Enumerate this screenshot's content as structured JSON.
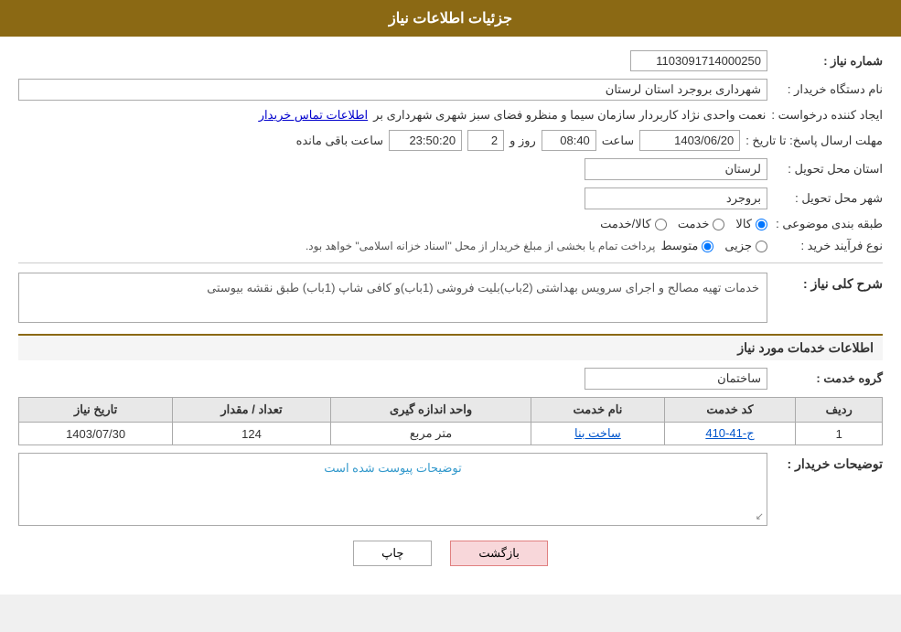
{
  "header": {
    "title": "جزئیات اطلاعات نیاز"
  },
  "fields": {
    "shomareNiaz_label": "شماره نیاز :",
    "shomareNiaz_value": "1103091714000250",
    "namDastgah_label": "نام دستگاه خریدار :",
    "namDastgah_value": "شهرداری بروجرد استان لرستان",
    "ijadKonande_label": "ایجاد کننده درخواست :",
    "ijadKonande_value": "نعمت واحدی نژاد کاربردار سازمان سیما و منظرو فضای سبز شهری شهرداری بر",
    "ijadKonande_link": "اطلاعات تماس خریدار",
    "mohlatErsal_label": "مهلت ارسال پاسخ: تا تاریخ :",
    "date_value": "1403/06/20",
    "time_value": "08:40",
    "days_value": "2",
    "remaining_value": "23:50:20",
    "ostanTahvil_label": "استان محل تحویل :",
    "ostanTahvil_value": "لرستان",
    "shahrTahvil_label": "شهر محل تحویل :",
    "shahrTahvil_value": "بروجرد",
    "tabaqeBandi_label": "طبقه بندی موضوعی :",
    "radio_options": [
      "کالا",
      "خدمت",
      "کالا/خدمت"
    ],
    "selected_radio": "کالا",
    "noeFarayand_label": "نوع فرآیند خرید :",
    "farayand_options": [
      "جزیی",
      "متوسط"
    ],
    "selected_farayand": "متوسط",
    "farayand_note": "پرداخت تمام یا بخشی از مبلغ خریدار از محل \"اسناد خزانه اسلامی\" خواهد بود.",
    "sharh_label": "شرح کلی نیاز :",
    "sharh_value": "خدمات تهیه مصالح و اجرای سرویس بهداشتی (2باب)بلیت فروشی (1باب)و کافی شاپ (1باب) طبق نقشه بیوستی",
    "service_section": "اطلاعات خدمات مورد نیاز",
    "grouhKhadamat_label": "گروه خدمت :",
    "grouhKhadamat_value": "ساختمان",
    "table": {
      "headers": [
        "ردیف",
        "کد خدمت",
        "نام خدمت",
        "واحد اندازه گیری",
        "تعداد / مقدار",
        "تاریخ نیاز"
      ],
      "rows": [
        {
          "radif": "1",
          "code": "ج-41-410",
          "name": "ساخت بنا",
          "unit": "متر مربع",
          "count": "124",
          "date": "1403/07/30"
        }
      ]
    },
    "tosehat_label": "توضیحات خریدار :",
    "tosehat_note": "توضیحات پیوست شده است",
    "buttons": {
      "print": "چاپ",
      "back": "بازگشت"
    },
    "saatLabel": "ساعت",
    "rozLabel": "روز و",
    "baqiLabel": "ساعت باقی مانده"
  }
}
